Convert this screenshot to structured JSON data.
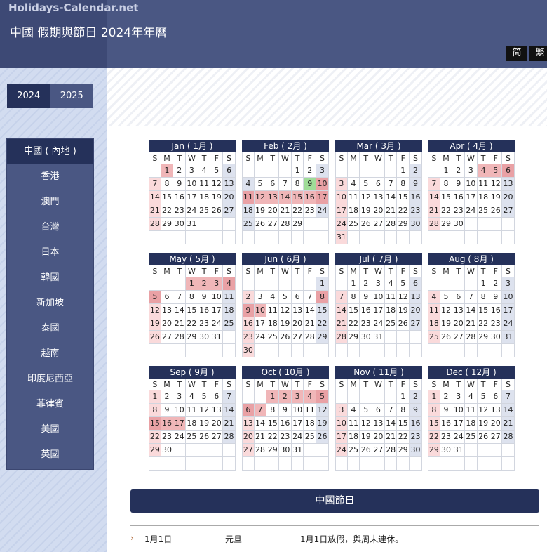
{
  "header": {
    "logo": "Holidays-Calendar.net",
    "title": "中國 假期與節日  2024年年曆",
    "lang_simplified": "简",
    "lang_traditional": "繁"
  },
  "years": [
    {
      "label": "2024",
      "active": true
    },
    {
      "label": "2025",
      "active": false
    }
  ],
  "regions": [
    {
      "label": "中國 ( 內地 )",
      "active": true
    },
    {
      "label": "香港"
    },
    {
      "label": "澳門"
    },
    {
      "label": "台灣"
    },
    {
      "label": "日本"
    },
    {
      "label": "韓國"
    },
    {
      "label": "新加坡"
    },
    {
      "label": "泰國"
    },
    {
      "label": "越南"
    },
    {
      "label": "印度尼西亞"
    },
    {
      "label": "菲律賓"
    },
    {
      "label": "美國"
    },
    {
      "label": "英國"
    }
  ],
  "weekdays": [
    "S",
    "M",
    "T",
    "W",
    "T",
    "F",
    "S"
  ],
  "colors": {
    "header": "#4a5783",
    "dark_navy": "#25315a",
    "weekend": "#dde2ee",
    "holiday": "#f0b6b8",
    "holiday_weekend": "#e9a1a5",
    "day_off": "#fadadb",
    "today": "#9fdc98"
  },
  "months": [
    {
      "label": "Jan ( 1月 )",
      "start": 1,
      "days": 31,
      "hol": [
        1
      ],
      "off": [
        7,
        14,
        21,
        28
      ]
    },
    {
      "label": "Feb ( 2月 )",
      "start": 4,
      "days": 29,
      "hol": [
        10,
        11,
        12,
        13,
        14,
        15,
        16,
        17
      ],
      "off": [],
      "today": 9
    },
    {
      "label": "Mar ( 3月 )",
      "start": 5,
      "days": 31,
      "hol": [],
      "off": [
        3,
        10,
        17,
        24,
        31
      ]
    },
    {
      "label": "Apr ( 4月 )",
      "start": 1,
      "days": 30,
      "hol": [
        4,
        5,
        6
      ],
      "off": [
        7,
        14,
        21,
        28
      ]
    },
    {
      "label": "May ( 5月 )",
      "start": 3,
      "days": 31,
      "hol": [
        1,
        2,
        3,
        4,
        5
      ],
      "off": [
        12,
        19,
        26
      ]
    },
    {
      "label": "Jun ( 6月 )",
      "start": 6,
      "days": 30,
      "hol": [
        8,
        9,
        10
      ],
      "off": [
        2,
        16,
        23,
        30
      ]
    },
    {
      "label": "Jul ( 7月 )",
      "start": 1,
      "days": 31,
      "hol": [],
      "off": [
        7,
        14,
        21,
        28
      ]
    },
    {
      "label": "Aug ( 8月 )",
      "start": 4,
      "days": 31,
      "hol": [],
      "off": [
        4,
        11,
        18,
        25
      ]
    },
    {
      "label": "Sep ( 9月 )",
      "start": 0,
      "days": 30,
      "hol": [
        15,
        16,
        17
      ],
      "off": [
        1,
        8,
        22,
        29
      ]
    },
    {
      "label": "Oct ( 10月 )",
      "start": 2,
      "days": 31,
      "hol": [
        1,
        2,
        3,
        4,
        5,
        6,
        7
      ],
      "off": [
        13,
        20,
        27
      ]
    },
    {
      "label": "Nov ( 11月 )",
      "start": 5,
      "days": 30,
      "hol": [],
      "off": [
        3,
        10,
        17,
        24
      ]
    },
    {
      "label": "Dec ( 12月 )",
      "start": 0,
      "days": 31,
      "hol": [],
      "off": [
        1,
        8,
        15,
        22,
        29
      ]
    }
  ],
  "section_title": "中國節日",
  "holidays": [
    {
      "date": "1月1日",
      "name": "元旦",
      "desc": "1月1日放假，與周末連休。"
    }
  ]
}
